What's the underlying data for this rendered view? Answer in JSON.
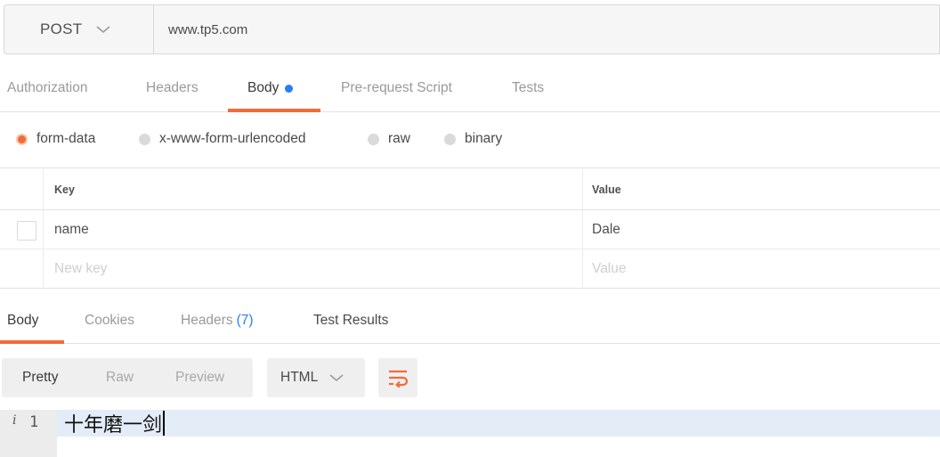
{
  "request": {
    "method": "POST",
    "url": "www.tp5.com"
  },
  "request_tabs": [
    {
      "label": "Authorization"
    },
    {
      "label": "Headers"
    },
    {
      "label": "Body",
      "active": true
    },
    {
      "label": "Pre-request Script"
    },
    {
      "label": "Tests"
    }
  ],
  "body_types": [
    {
      "label": "form-data",
      "selected": true
    },
    {
      "label": "x-www-form-urlencoded"
    },
    {
      "label": "raw"
    },
    {
      "label": "binary"
    }
  ],
  "params_table": {
    "headers": {
      "key": "Key",
      "value": "Value"
    },
    "rows": [
      {
        "key": "name",
        "value": "Dale"
      }
    ],
    "new_row": {
      "key_placeholder": "New key",
      "value_placeholder": "Value"
    }
  },
  "response_tabs": [
    {
      "label": "Body",
      "active": true
    },
    {
      "label": "Cookies"
    },
    {
      "label": "Headers",
      "count": "(7)"
    },
    {
      "label": "Test Results"
    }
  ],
  "view_modes": [
    {
      "label": "Pretty",
      "active": true
    },
    {
      "label": "Raw"
    },
    {
      "label": "Preview"
    }
  ],
  "language": "HTML",
  "editor": {
    "info_marker": "i",
    "line_number": "1",
    "line_text": "十年磨一剑"
  },
  "colors": {
    "accent": "#f26b3a",
    "dot": "#2a7df5",
    "count": "#2a7df5",
    "line_highlight": "#e4ecf8"
  },
  "icons": {
    "method_dropdown": "chevron-down-icon",
    "language_dropdown": "chevron-down-icon",
    "wrap": "wrap-lines-icon"
  }
}
